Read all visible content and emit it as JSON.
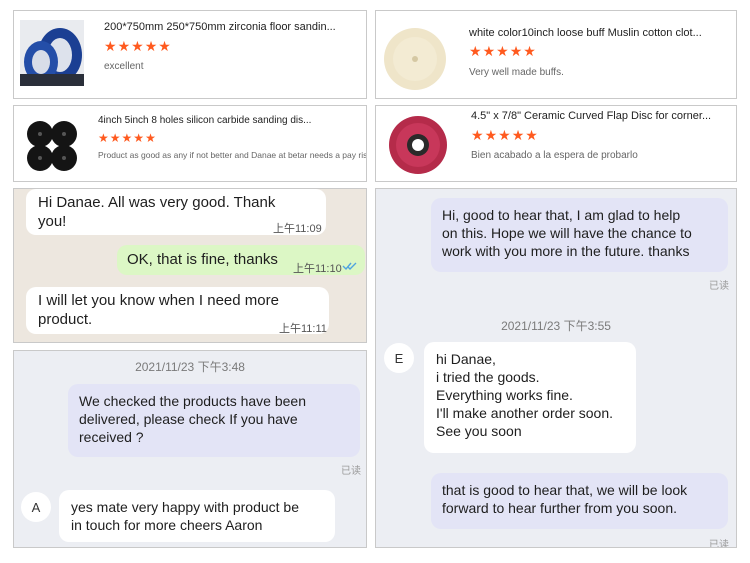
{
  "reviews": [
    {
      "title": "200*750mm 250*750mm zirconia floor sandin...",
      "comment": "excellent",
      "stars": 5,
      "image": "blue-sanding-belt"
    },
    {
      "title": "white color10inch loose buff Muslin cotton clot...",
      "comment": "Very well made buffs.",
      "stars": 5,
      "image": "cotton-buff-wheel"
    },
    {
      "title": "4inch 5inch 8 holes silicon carbide sanding dis...",
      "comment": "Product as good as any if not better and Danae at betar needs a pay rise",
      "stars": 5,
      "image": "black-sanding-discs"
    },
    {
      "title": "4.5\" x 7/8\" Ceramic Curved Flap Disc for corner...",
      "comment": "Bien acabado a la espera de probarlo",
      "stars": 5,
      "image": "red-flap-disc"
    }
  ],
  "star_glyph": "★",
  "chat1": {
    "messages": [
      {
        "lines": [
          "Hi Danae. All was very good. Thank",
          "you!"
        ],
        "time": "上午11:09"
      },
      {
        "lines": [
          "OK, that is fine, thanks"
        ],
        "time": "上午11:10",
        "status": "read-double-check-icon"
      },
      {
        "lines": [
          "I will let you know when I need more",
          "product."
        ],
        "time": "上午11:11"
      }
    ]
  },
  "chat2": {
    "date": "2021/11/23 下午3:48",
    "msg1": [
      "We checked the products have been",
      "delivered, please check If you have",
      "received ?"
    ],
    "read": "已读",
    "avatar": "A",
    "msg2": [
      "yes mate very  happy with product   be",
      "in touch for more cheers Aaron"
    ]
  },
  "chat3": {
    "msg1": [
      "Hi, good to hear that, I am glad to help",
      "on this. Hope we will have the chance to",
      "work with you more in the future. thanks"
    ],
    "read1": "已读",
    "date": "2021/11/23 下午3:55",
    "avatar": "E",
    "msg2": [
      "hi Danae,",
      "i tried the goods.",
      "Everything works fine.",
      "I'll make another order soon.",
      "See you soon"
    ],
    "msg3": [
      "that is good to hear that, we will be look",
      "forward to hear further from you soon."
    ],
    "read2": "已读"
  },
  "colors": {
    "star": "#ff5a1f",
    "whatsapp_green": "#dcf7c5",
    "purple_bubble": "#e3e4f6",
    "check_blue": "#4fa3e0"
  }
}
